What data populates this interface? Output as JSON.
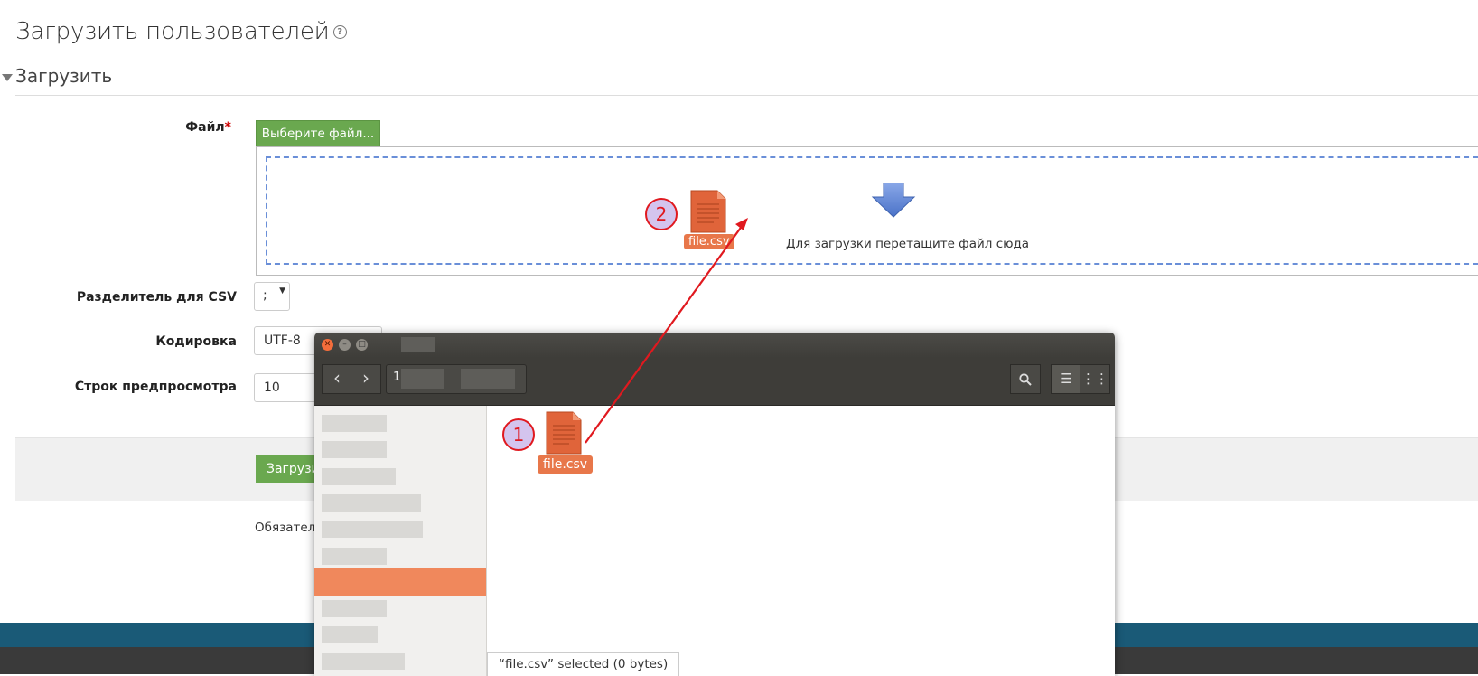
{
  "page": {
    "title": "Загрузить пользователей",
    "help_icon": "question-circle-icon",
    "section_title": "Загрузить"
  },
  "form": {
    "file_label": "Файл",
    "required_mark": "*",
    "choose_button": "Выберите файл...",
    "drop_hint": "Для загрузки перетащите файл сюда",
    "csv_separator_label": "Разделитель для CSV",
    "csv_separator_value": ";",
    "encoding_label": "Кодировка",
    "encoding_value": "UTF-8",
    "preview_rows_label": "Строк предпросмотра",
    "preview_rows_value": "10",
    "submit_button": "Загрузить",
    "required_note": "Обязатель"
  },
  "annotations": {
    "step1": "1",
    "step2": "2",
    "dragged_file": "file.csv",
    "arrow_color": "#e0191f"
  },
  "file_manager": {
    "file_name": "file.csv",
    "path_first_char": "1",
    "status": "“file.csv” selected  (0 bytes)"
  },
  "colors": {
    "accent_green": "#6aa84f",
    "file_orange": "#e8774a",
    "footer_blue": "#1a5a77"
  }
}
